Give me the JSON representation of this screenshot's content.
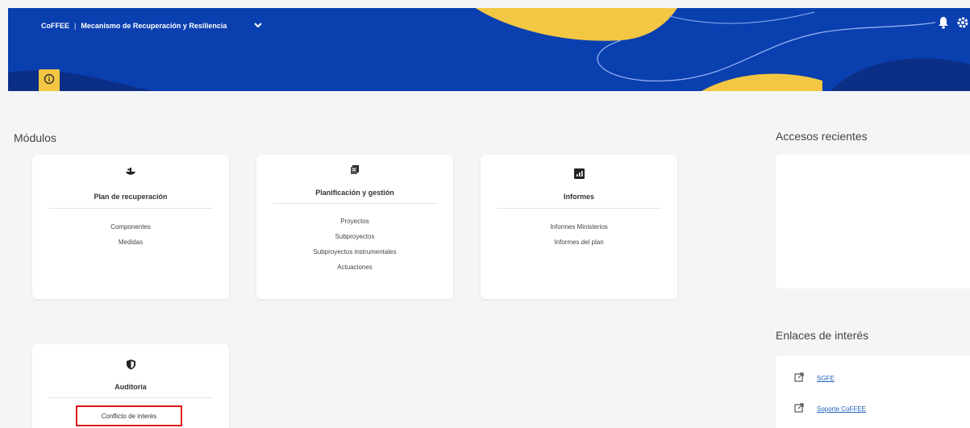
{
  "header": {
    "app_name": "CoFFEE",
    "separator": "|",
    "module_name": "Mecanismo de Recuperación y Resiliencia",
    "colors": {
      "primary": "#0a3fb0",
      "accent": "#f3c743"
    }
  },
  "sections": {
    "modules_title": "Módulos",
    "recent_title": "Accesos recientes",
    "links_title": "Enlaces de interés"
  },
  "cards": [
    {
      "title": "Plan de recuperación",
      "icon": "plant-icon",
      "links": [
        "Componentes",
        "Medidas"
      ]
    },
    {
      "title": "Planificación y gestión",
      "icon": "documents-icon",
      "links": [
        "Proyectos",
        "Subproyectos",
        "Subproyectos instrumentales",
        "Actuaciones"
      ]
    },
    {
      "title": "Informes",
      "icon": "report-icon",
      "links": [
        "Informes Ministerios",
        "Informes del plan"
      ]
    },
    {
      "title": "Auditoría",
      "icon": "shield-icon",
      "links": [
        "Conflicto de interés"
      ]
    }
  ],
  "external_links": [
    {
      "label": "SGFE",
      "icon": "external-link-icon"
    },
    {
      "label": "Soporte CoFFEE",
      "icon": "external-link-icon"
    }
  ]
}
